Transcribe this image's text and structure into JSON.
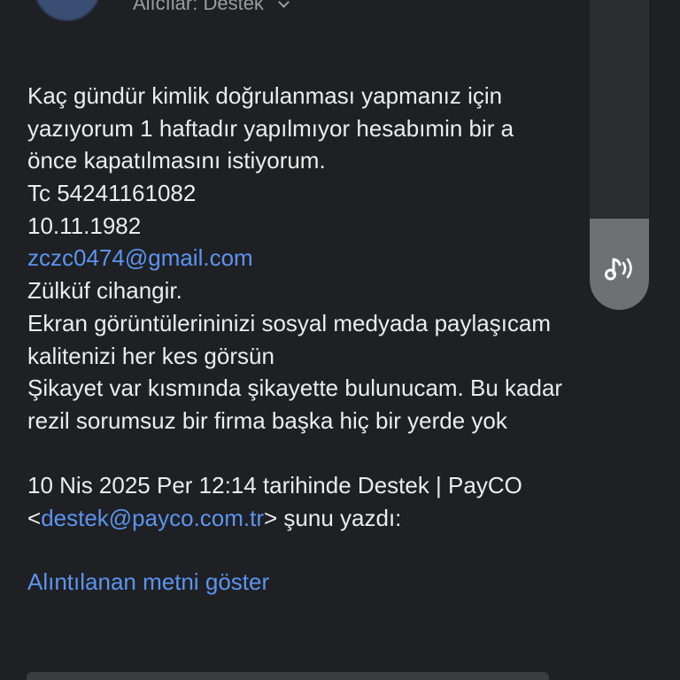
{
  "header": {
    "recipients": "Alıcılar: Destek"
  },
  "message": {
    "lines": [
      "Kaç gündür kimlik doğrulanması yapmanız için",
      "yazıyorum 1 haftadır yapılmıyor hesabımin bir a",
      "önce kapatılmasını istiyorum.",
      "Tc 54241161082",
      "10.11.1982",
      "zczc0474@gmail.com",
      "Zülküf cihangir.",
      "Ekran görüntülerininizi sosyal medyada paylaşıcam",
      "kalitenizi her kes görsün",
      "Şikayet var kısmında şikayette bulunucam. Bu kadar",
      "rezil sorumsuz bir firma başka hiç bir yerde yok"
    ],
    "quote_header_line1": "10 Nis 2025 Per 12:14 tarihinde Destek | PayCO",
    "quote_header_open": "<",
    "quote_header_email": "destek@payco.com.tr",
    "quote_header_close": "> şunu yazdı:"
  },
  "show_quoted_label": "Alıntılanan metni göster",
  "icons": {
    "recipients_toggle": "chevron-down-icon",
    "read_aloud": "text-to-speech-icon"
  },
  "colors": {
    "background": "#1f2023",
    "text": "#ececec",
    "link": "#5b94f0",
    "muted": "#9a9ca1"
  }
}
